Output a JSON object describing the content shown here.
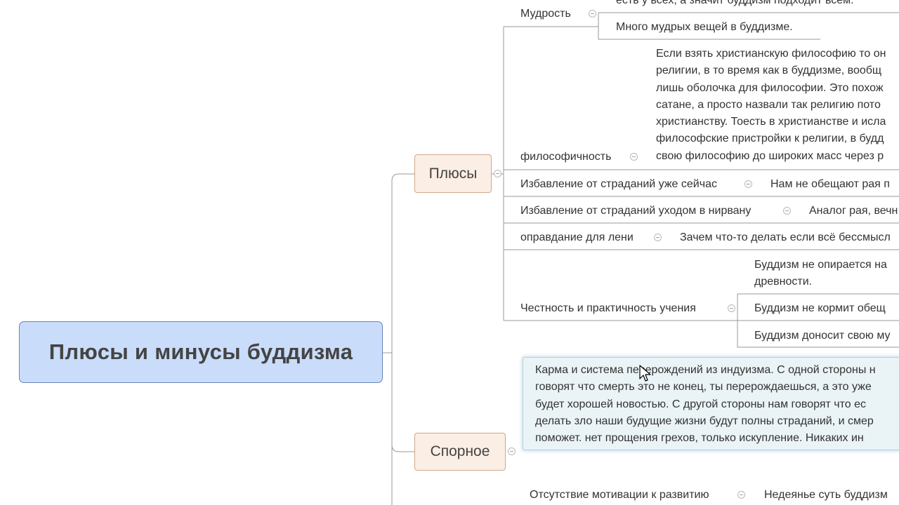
{
  "central_topic": "Плюсы и минусы буддизма",
  "main_topics": {
    "pros": "Плюсы",
    "controversial": "Спорное"
  },
  "pros_items": {
    "wisdom": {
      "label": "Мудрость",
      "notes": [
        "есть у всех, а значит буддизм подходит всем.",
        "Много мудрых вещей в буддизме."
      ]
    },
    "philosophy": {
      "label": "философичность",
      "lines": [
        "Если взять христианскую философию то он",
        "религии, в то время как в буддизме, вообщ",
        "лишь оболочка для философии. Это похож",
        "сатане, а просто назвали так религию пото",
        "христианству. Тоесть в христианстве и исла",
        "философские пристройки к религии, в будд",
        "свою философию до широких масс через р"
      ]
    },
    "relief_now": {
      "label": "Избавление от страданий уже сейчас",
      "note": "Нам не обещают рая п"
    },
    "relief_nirvana": {
      "label": "Избавление от страданий уходом в нирвану",
      "note": "Аналог рая, вечн"
    },
    "laziness": {
      "label": "оправдание для лени",
      "note": "Зачем что-то делать если всё бессмысл"
    },
    "honesty": {
      "label": "Честность и практичность учения",
      "note_lines": [
        "Буддизм не опирается на",
        "древности."
      ],
      "notes": [
        "Буддизм не кормит обещ",
        "Буддизм доносит свою му"
      ]
    }
  },
  "controversial_items": {
    "karma_lines": [
      "Карма и система перерождений из индуизма. С одной стороны н",
      "говорят что смерть это не конец, ты перерождаешься, а это уже",
      "будет хорошей новостью. С другой стороны нам  говорят что ес",
      "делать зло наши будущие жизни будут полны страданий, и смер",
      "поможет. нет прощения грехов, только искупление. Никаких ин"
    ],
    "motivation": {
      "label": "Отсутствие мотивации к развитию",
      "note": "Недеянье суть буддизм"
    }
  },
  "colors": {
    "central_fill": "#c9dcf9",
    "central_border": "#6a86b6",
    "main_fill": "#fbeee4",
    "main_border": "#cfa88d",
    "topic_box_fill": "#eaf3f6",
    "line": "#9a9a9a"
  },
  "icons": [
    "collapse-icon",
    "mouse-cursor-icon"
  ]
}
